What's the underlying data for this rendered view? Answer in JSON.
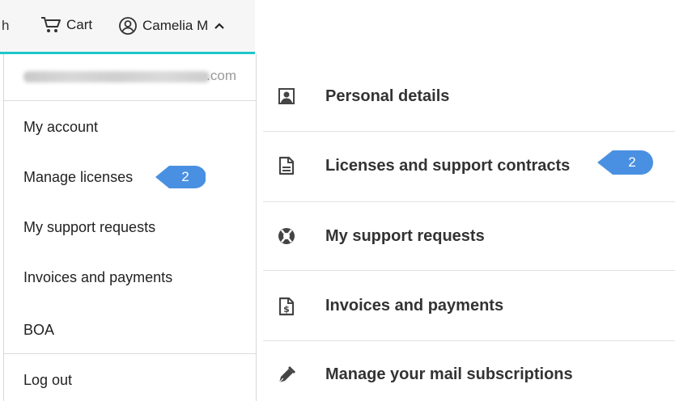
{
  "header": {
    "truncated_text": "h",
    "cart_label": "Cart",
    "user_name": "Camelia M",
    "accent_color": "#1ec7c9"
  },
  "dropdown": {
    "email_domain": ".com",
    "items": [
      {
        "label": "My account"
      },
      {
        "label": "Manage licenses"
      },
      {
        "label": "My support requests"
      },
      {
        "label": "Invoices and payments"
      },
      {
        "label": "BOA"
      },
      {
        "label": "Log out"
      }
    ]
  },
  "callouts": {
    "left_number": "2",
    "right_number": "2",
    "color": "#4a90e2"
  },
  "panel": {
    "items": [
      {
        "label": "Personal details",
        "icon": "person-portrait-icon"
      },
      {
        "label": "Licenses and support contracts",
        "icon": "document-icon"
      },
      {
        "label": "My support requests",
        "icon": "lifebuoy-icon"
      },
      {
        "label": "Invoices and payments",
        "icon": "invoice-dollar-icon"
      },
      {
        "label": "Manage your mail subscriptions",
        "icon": "pen-icon"
      }
    ]
  }
}
